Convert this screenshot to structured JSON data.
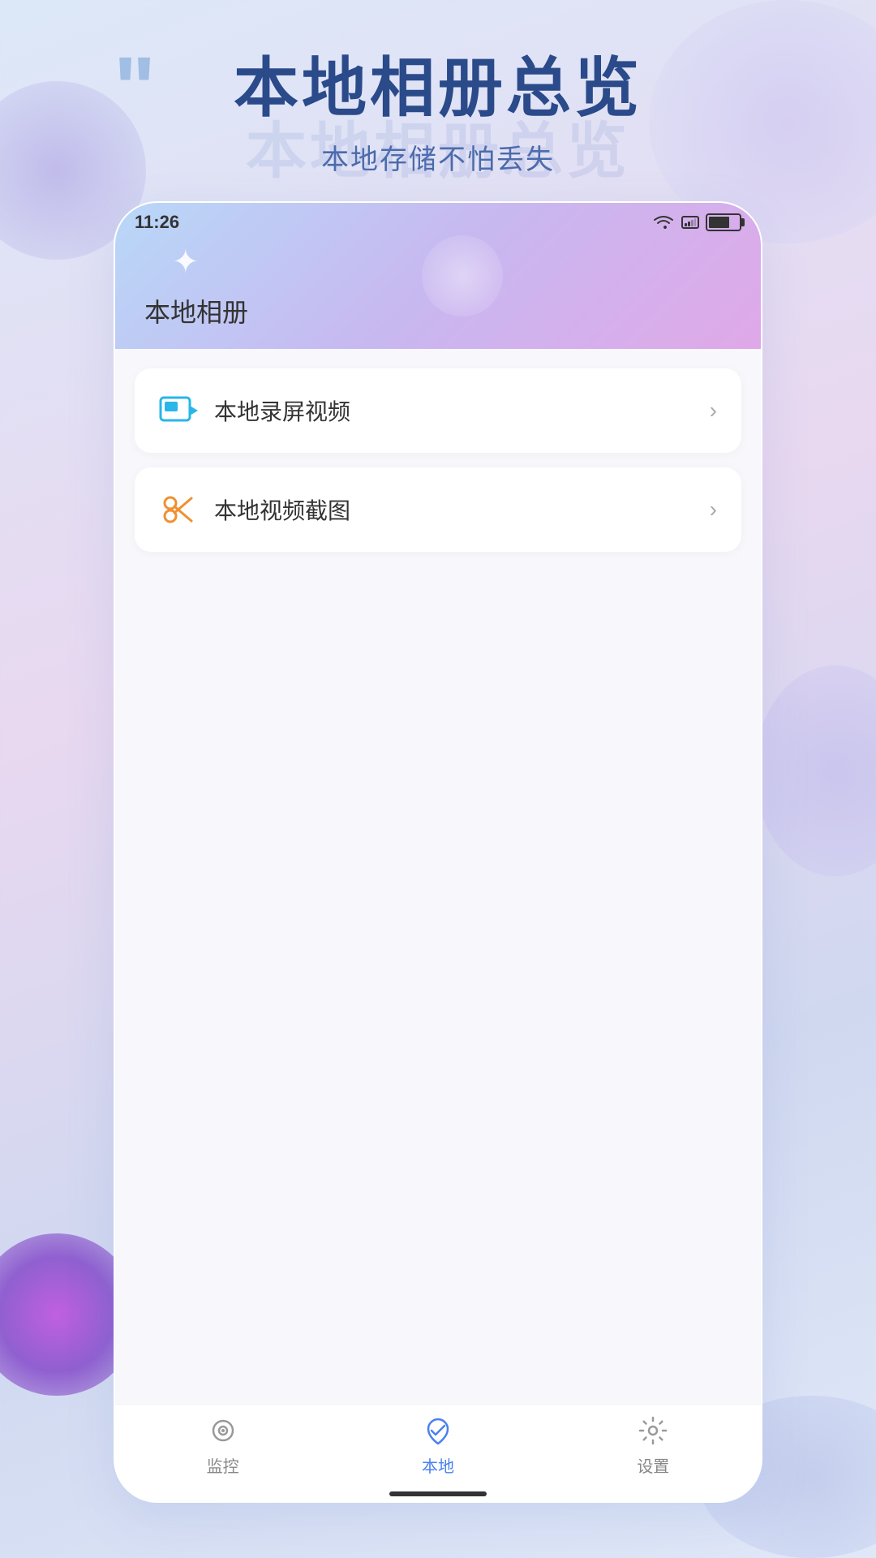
{
  "background": {
    "gradient": "linear-gradient(160deg, #dce8f8 0%, #e8d8f0 40%, #d0d8f0 70%, #e0e8f8 100%)"
  },
  "hero": {
    "quote_symbol": "“",
    "title": "本地相册总览",
    "watermark": "本地相册总览",
    "subtitle": "本地存储不怕丢失"
  },
  "status_bar": {
    "time": "11:26"
  },
  "phone": {
    "page_title": "本地相册",
    "menu_items": [
      {
        "id": "screen_record",
        "icon_type": "screen-record",
        "icon_color": "#29b6e8",
        "label": "本地录屏视频"
      },
      {
        "id": "video_screenshot",
        "icon_type": "scissors",
        "icon_color": "#f09030",
        "label": "本地视频截图"
      }
    ]
  },
  "nav": {
    "items": [
      {
        "id": "monitor",
        "label": "监控",
        "active": false
      },
      {
        "id": "local",
        "label": "本地",
        "active": true
      },
      {
        "id": "settings",
        "label": "设置",
        "active": false
      }
    ]
  }
}
